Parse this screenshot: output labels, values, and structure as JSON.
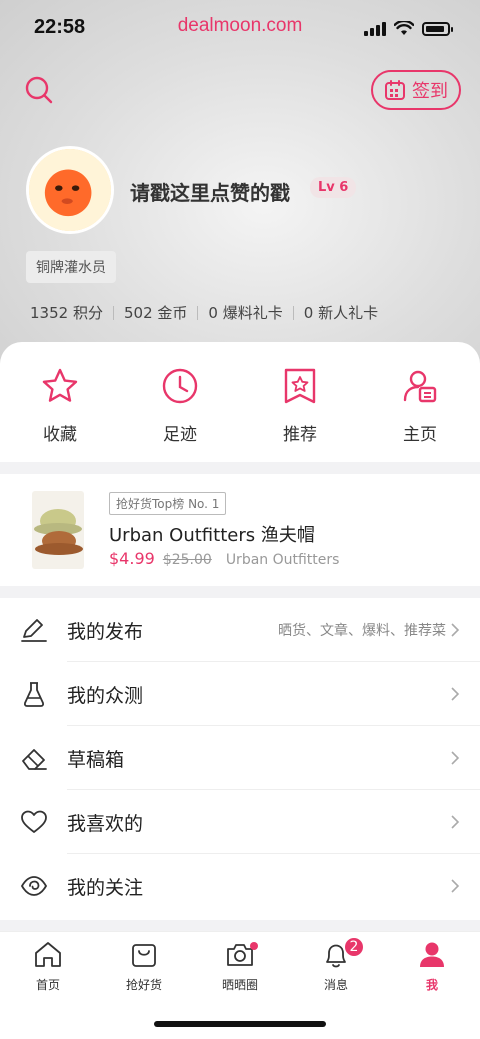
{
  "status": {
    "time": "22:58",
    "url": "dealmoon.com"
  },
  "header": {
    "checkin_label": "签到"
  },
  "profile": {
    "username": "请戳这里点赞的戳",
    "level": "Lv 6",
    "badge": "铜牌灌水员",
    "stats": [
      {
        "value": "1352",
        "label": "积分"
      },
      {
        "value": "502",
        "label": "金币"
      },
      {
        "value": "0",
        "label": "爆料礼卡"
      },
      {
        "value": "0",
        "label": "新人礼卡"
      }
    ]
  },
  "actions": [
    {
      "label": "收藏",
      "icon": "star-icon"
    },
    {
      "label": "足迹",
      "icon": "clock-icon"
    },
    {
      "label": "推荐",
      "icon": "bookmark-star-icon"
    },
    {
      "label": "主页",
      "icon": "profile-card-icon"
    }
  ],
  "product": {
    "rank_tag": "抢好货Top榜 No. 1",
    "title": "Urban Outfitters 渔夫帽",
    "price": "$4.99",
    "old_price": "$25.00",
    "merchant": "Urban Outfitters"
  },
  "menu": [
    {
      "title": "我的发布",
      "hint": "晒货、文章、爆料、推荐菜",
      "icon": "pen-icon"
    },
    {
      "title": "我的众测",
      "hint": "",
      "icon": "flask-icon"
    },
    {
      "title": "草稿箱",
      "hint": "",
      "icon": "eraser-icon"
    },
    {
      "title": "我喜欢的",
      "hint": "",
      "icon": "heart-icon"
    },
    {
      "title": "我的关注",
      "hint": "",
      "icon": "eye-icon"
    }
  ],
  "tabs": [
    {
      "label": "首页",
      "icon": "home-icon"
    },
    {
      "label": "抢好货",
      "icon": "shopping-bag-icon"
    },
    {
      "label": "晒晒圈",
      "icon": "camera-icon"
    },
    {
      "label": "消息",
      "icon": "bell-icon",
      "badge": "2"
    },
    {
      "label": "我",
      "icon": "person-icon"
    }
  ],
  "colors": {
    "accent": "#e8366a"
  }
}
